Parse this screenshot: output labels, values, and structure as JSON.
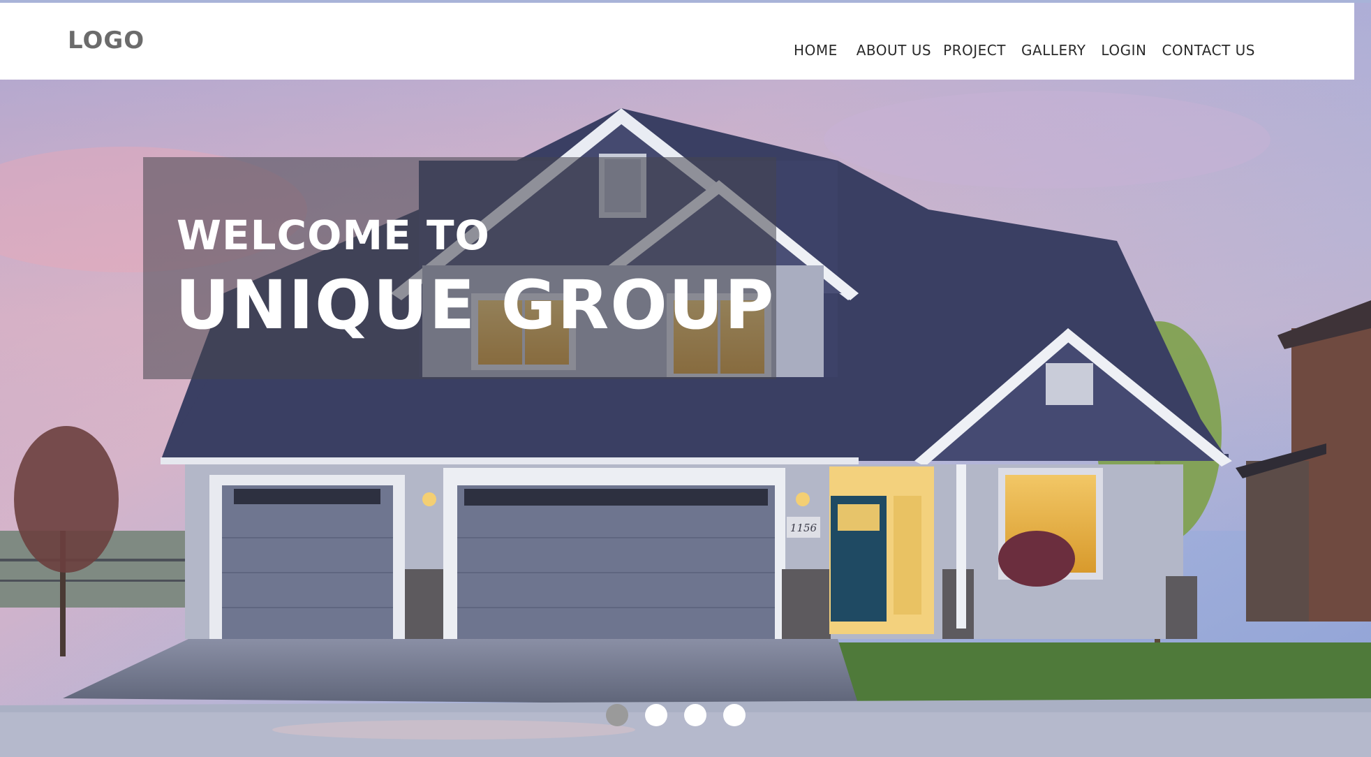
{
  "header": {
    "logo": "LOGO",
    "nav": [
      {
        "label": "HOME"
      },
      {
        "label": "ABOUT US"
      },
      {
        "label": "PROJECT"
      },
      {
        "label": "GALLERY"
      },
      {
        "label": "LOGIN"
      },
      {
        "label": "CONTACT US"
      }
    ]
  },
  "hero": {
    "line1": "WELCOME TO",
    "line2": "UNIQUE GROUP",
    "address_plate": "1156"
  },
  "slider": {
    "dots": 4,
    "active_index": 0
  },
  "colors": {
    "nav_text": "#2a2a2a",
    "logo_text": "#6b6b6b",
    "overlay": "#46464e",
    "dot_active": "#9a9a9a",
    "dot_inactive": "#ffffff",
    "roof": "#3a3f63",
    "siding": "#a9adc0",
    "door": "#1f4a63"
  }
}
